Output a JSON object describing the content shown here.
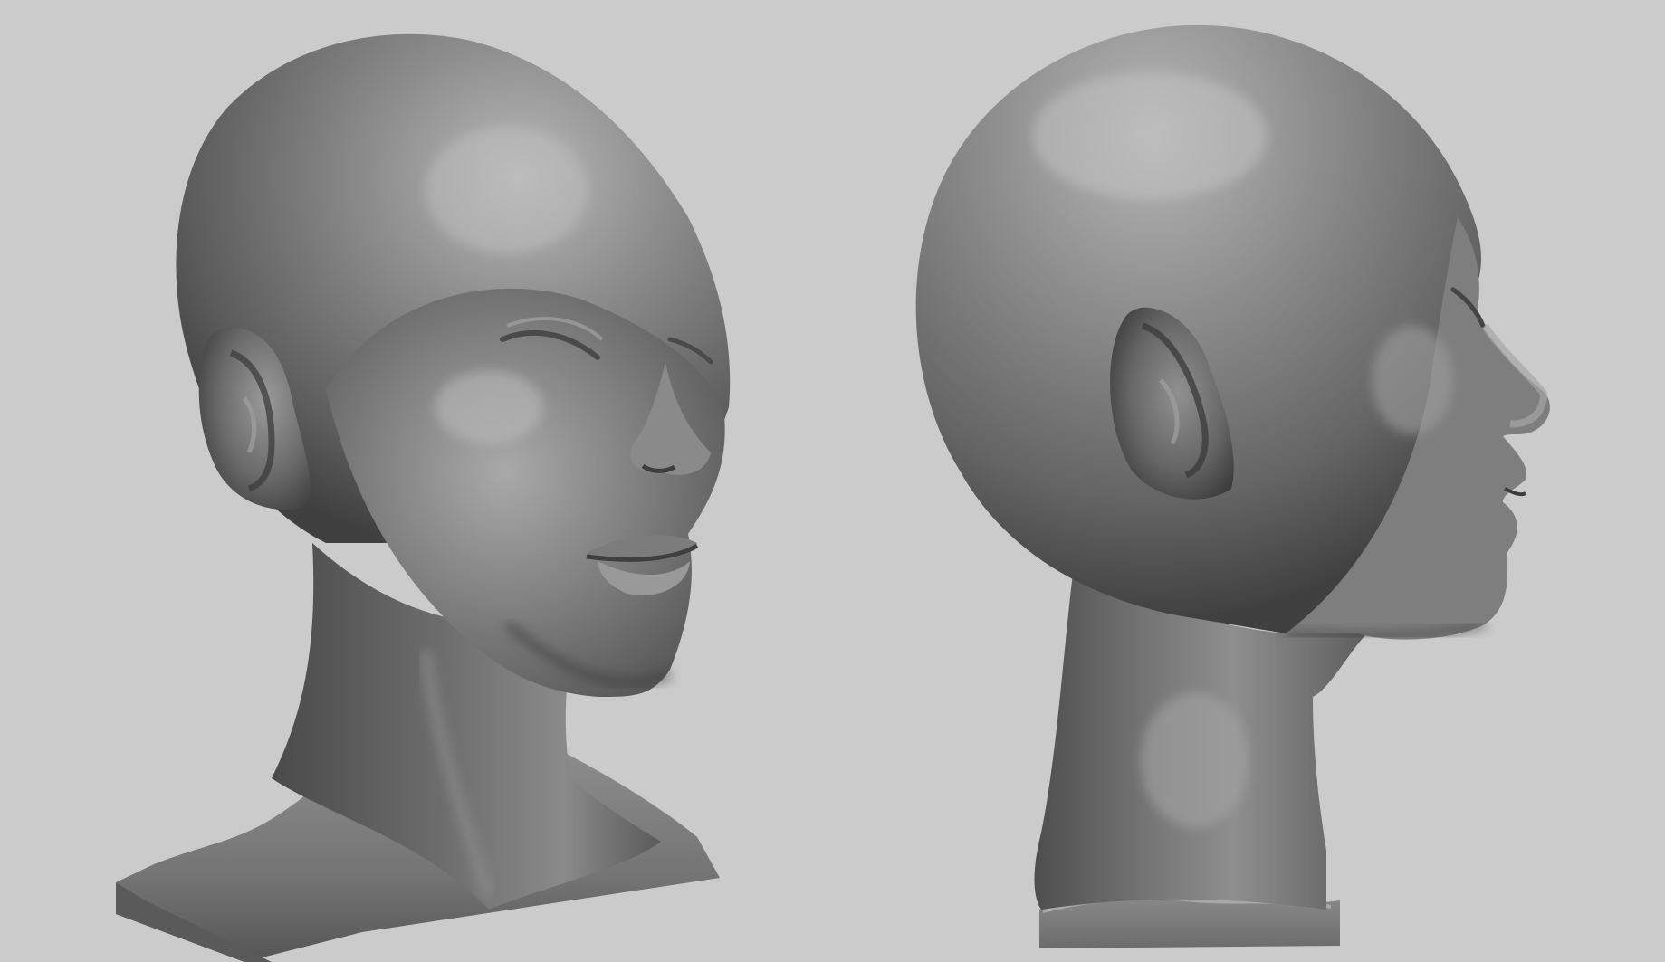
{
  "scene": {
    "background_color": "#cbcbcb",
    "material_color": "#7a7a7a",
    "highlight_color": "#b4b4b4",
    "shadow_color": "#3c3c3c",
    "views": [
      {
        "name": "three-quarter",
        "icon": "head-three-quarter-view"
      },
      {
        "name": "profile",
        "icon": "head-side-profile-view"
      }
    ]
  }
}
